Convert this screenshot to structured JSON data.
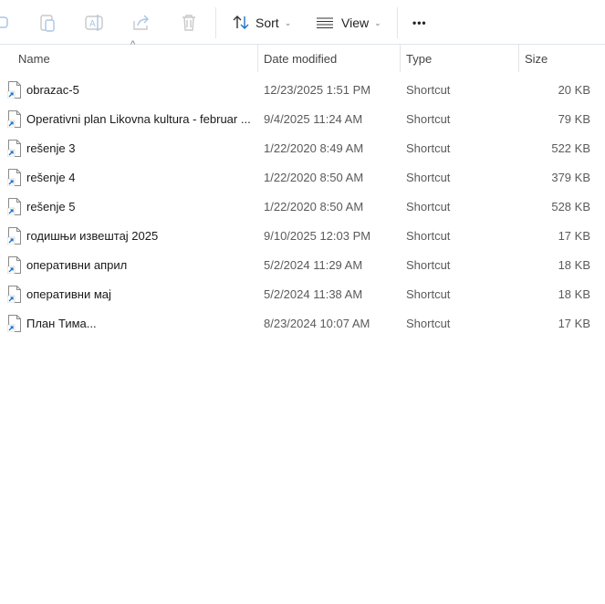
{
  "toolbar": {
    "sort_label": "Sort",
    "view_label": "View",
    "more_label": "•••",
    "icons": [
      "partial-icon",
      "paste-icon",
      "rename-icon",
      "share-icon",
      "delete-icon",
      "sort-icon",
      "view-icon",
      "more-icon"
    ]
  },
  "columns": {
    "name": "Name",
    "date": "Date modified",
    "type": "Type",
    "size": "Size"
  },
  "sort_indicator": "^",
  "files": [
    {
      "name": "obrazac-5",
      "date": "12/23/2025 1:51 PM",
      "type": "Shortcut",
      "size": "20 KB"
    },
    {
      "name": "Operativni plan Likovna kultura - februar ...",
      "date": "9/4/2025 11:24 AM",
      "type": "Shortcut",
      "size": "79 KB"
    },
    {
      "name": "rešenje 3",
      "date": "1/22/2020 8:49 AM",
      "type": "Shortcut",
      "size": "522 KB"
    },
    {
      "name": "rešenje 4",
      "date": "1/22/2020 8:50 AM",
      "type": "Shortcut",
      "size": "379 KB"
    },
    {
      "name": "rešenje 5",
      "date": "1/22/2020 8:50 AM",
      "type": "Shortcut",
      "size": "528 KB"
    },
    {
      "name": "годишњи извештај 2025",
      "date": "9/10/2025 12:03 PM",
      "type": "Shortcut",
      "size": "17 KB"
    },
    {
      "name": "оперативни април",
      "date": "5/2/2024 11:29 AM",
      "type": "Shortcut",
      "size": "18 KB"
    },
    {
      "name": "оперативни мај",
      "date": "5/2/2024 11:38 AM",
      "type": "Shortcut",
      "size": "18 KB"
    },
    {
      "name": "План Тима...",
      "date": "8/23/2024 10:07 AM",
      "type": "Shortcut",
      "size": "17 KB"
    }
  ]
}
